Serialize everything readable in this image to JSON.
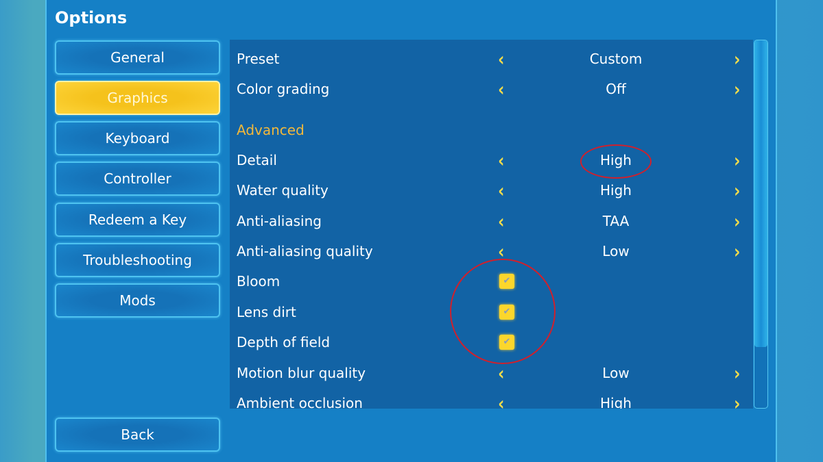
{
  "window": {
    "title": "Options"
  },
  "sidebar": {
    "items": [
      {
        "label": "General",
        "active": false
      },
      {
        "label": "Graphics",
        "active": true
      },
      {
        "label": "Keyboard",
        "active": false
      },
      {
        "label": "Controller",
        "active": false
      },
      {
        "label": "Redeem a Key",
        "active": false
      },
      {
        "label": "Troubleshooting",
        "active": false
      },
      {
        "label": "Mods",
        "active": false
      }
    ],
    "back_label": "Back"
  },
  "settings": {
    "preset": {
      "label": "Preset",
      "value": "Custom"
    },
    "color_grading": {
      "label": "Color grading",
      "value": "Off"
    },
    "advanced_heading": "Advanced",
    "detail": {
      "label": "Detail",
      "value": "High"
    },
    "water_quality": {
      "label": "Water quality",
      "value": "High"
    },
    "anti_aliasing": {
      "label": "Anti-aliasing",
      "value": "TAA"
    },
    "aa_quality": {
      "label": "Anti-aliasing quality",
      "value": "Low"
    },
    "bloom": {
      "label": "Bloom",
      "checked": true
    },
    "lens_dirt": {
      "label": "Lens dirt",
      "checked": true
    },
    "depth_of_field": {
      "label": "Depth of field",
      "checked": true
    },
    "motion_blur": {
      "label": "Motion blur quality",
      "value": "Low"
    },
    "ambient_occlusion": {
      "label": "Ambient occlusion",
      "value": "High"
    }
  },
  "glyphs": {
    "prev": "‹",
    "next": "›",
    "check": "✔"
  },
  "colors": {
    "accent": "#fcd62c",
    "panel": "#1580c6",
    "content": "#1263a5",
    "annotation": "#d0202c"
  }
}
